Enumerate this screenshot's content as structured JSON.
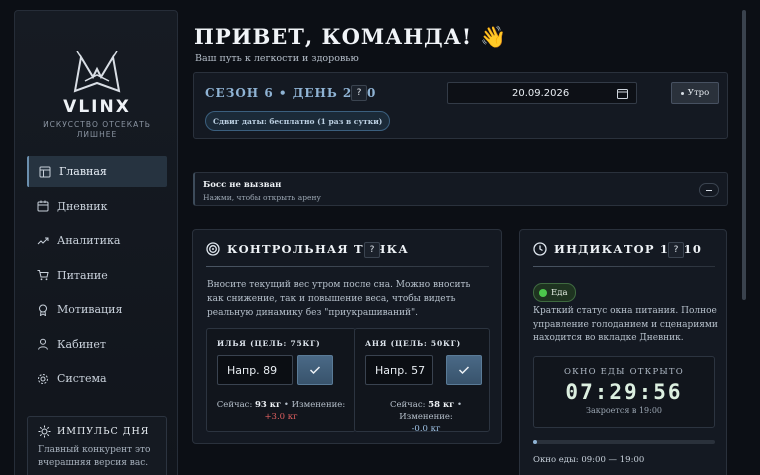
{
  "brand": {
    "name": "VLINX",
    "tagline": "ИСКУССТВО ОТСЕКАТЬ ЛИШНЕЕ"
  },
  "nav": [
    {
      "label": "Главная",
      "icon": "layout-icon",
      "active": true
    },
    {
      "label": "Дневник",
      "icon": "calendar-icon"
    },
    {
      "label": "Аналитика",
      "icon": "trend-icon"
    },
    {
      "label": "Питание",
      "icon": "cart-icon"
    },
    {
      "label": "Мотивация",
      "icon": "medal-icon"
    },
    {
      "label": "Кабинет",
      "icon": "user-icon"
    },
    {
      "label": "Система",
      "icon": "gear-icon"
    }
  ],
  "pulse": {
    "title": "ИМПУЛЬС ДНЯ",
    "text": "Главный конкурент это вчерашняя версия вас."
  },
  "header": {
    "title": "ПРИВЕТ, КОМАНДА! 👋",
    "subtitle": "Ваш путь к легкости и здоровью"
  },
  "season": {
    "title": "СЕЗОН 6 • ДЕНЬ 2/30",
    "help": "?",
    "date": "20.09.2026",
    "time_button": "Утро",
    "shift": "Сдвиг даты: бесплатно (1 раз в сутки)"
  },
  "boss": {
    "title": "Босс не вызван",
    "subtitle": "Нажми, чтобы открыть арену"
  },
  "checkpoint": {
    "title": "КОНТРОЛЬНАЯ ТОЧКА",
    "help": "?",
    "description": "Вносите текущий вес утром после сна. Можно вносить как снижение, так и повышение веса, чтобы видеть реальную динамику без \"приукрашиваний\".",
    "people": [
      {
        "label": "ИЛЬЯ (ЦЕЛЬ: 75КГ)",
        "input_value": "Напр. 89",
        "now_label": "Сейчас:",
        "now_value": "93 кг",
        "change_label": "• Изменение:",
        "change_value": "+3.0 кг"
      },
      {
        "label": "АНЯ (ЦЕЛЬ: 50КГ)",
        "input_value": "Напр. 57",
        "now_label": "Сейчас:",
        "now_value": "58 кг",
        "change_label": "• Изменение:",
        "change_value": "-0.0 кг"
      }
    ]
  },
  "indicator": {
    "title": "ИНДИКАТОР 14/10",
    "help": "?",
    "status": "Еда",
    "description": "Краткий статус окна питания. Полное управление голоданием и сценариями находится во вкладке Дневник.",
    "timer_label": "ОКНО ЕДЫ ОТКРЫТО",
    "timer": "07:29:56",
    "closes": "Закроется в 19:00",
    "progress": 0.02,
    "window": "Окно еды: 09:00 — 19:00"
  },
  "colors": {
    "accent": "#8fb3d4",
    "positive_delta": "#e06060",
    "status_green": "#4cc74c"
  }
}
